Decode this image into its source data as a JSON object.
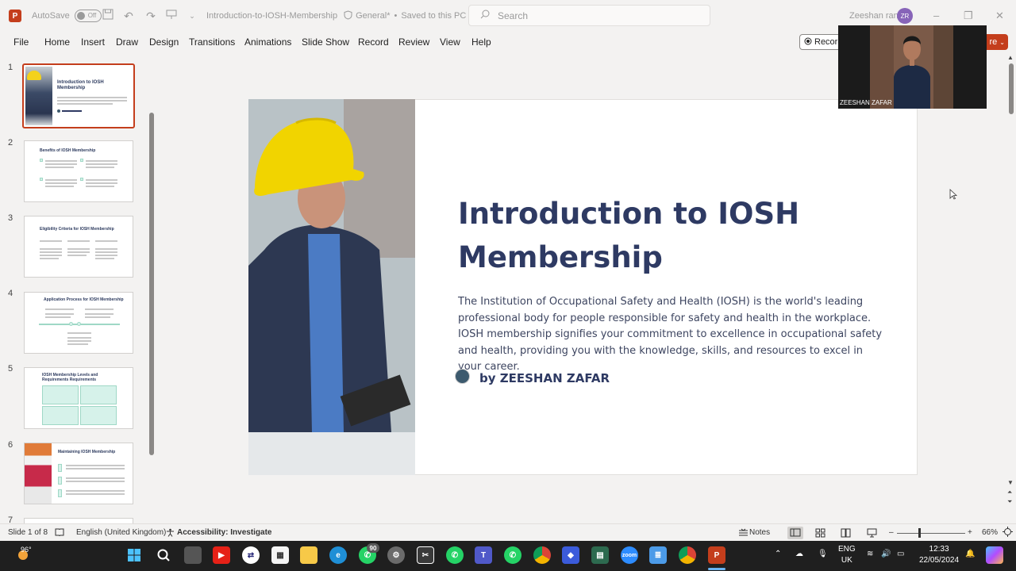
{
  "titlebar": {
    "app_logo": "P",
    "autosave_label": "AutoSave",
    "autosave_state": "Off",
    "file_name": "Introduction-to-IOSH-Membership",
    "sensitivity": "General*",
    "save_status": "Saved to this PC",
    "search_placeholder": "Search",
    "user_name": "Zeeshan rana",
    "user_initials": "ZR"
  },
  "menu": {
    "items": [
      "File",
      "Home",
      "Insert",
      "Draw",
      "Design",
      "Transitions",
      "Animations",
      "Slide Show",
      "Record",
      "Review",
      "View",
      "Help"
    ],
    "record_label": "Record",
    "share_label": "re"
  },
  "thumbnails": [
    {
      "num": "1",
      "title": "Introduction to IOSH Membership"
    },
    {
      "num": "2",
      "title": "Benefits of IOSH Membership"
    },
    {
      "num": "3",
      "title": "Eligibility Criteria for IOSH Membership"
    },
    {
      "num": "4",
      "title": "Application Process for IOSH Membership"
    },
    {
      "num": "5",
      "title": "IOSH Membership Levels and Requirements Requirements"
    },
    {
      "num": "6",
      "title": "Maintaining IOSH Membership"
    },
    {
      "num": "7",
      "title": ""
    }
  ],
  "slide": {
    "title": "Introduction to IOSH Membership",
    "body": "The Institution of Occupational Safety and Health (IOSH) is the world's leading professional body for people responsible for safety and health in the workplace. IOSH membership signifies your commitment to excellence in occupational safety and health, providing you with the knowledge, skills, and resources to excel in your career.",
    "byline": "by ZEESHAN ZAFAR"
  },
  "webcam": {
    "name": "ZEESHAN ZAFAR"
  },
  "status": {
    "slide_counter": "Slide 1 of 8",
    "language": "English (United Kingdom)",
    "accessibility": "Accessibility: Investigate",
    "notes": "Notes",
    "zoom": "66%"
  },
  "taskbar": {
    "weather": "96°",
    "whatsapp_badge": "90",
    "lang_top": "ENG",
    "lang_bottom": "UK",
    "time": "12:33",
    "date": "22/05/2024"
  },
  "colors": {
    "accent": "#c43e1c",
    "title": "#2e3a63",
    "taskbar": "#1f1f1f"
  }
}
